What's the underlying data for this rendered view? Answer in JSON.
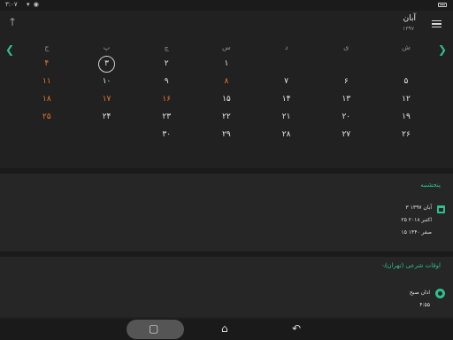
{
  "status": {
    "time": "۳:۰۷",
    "signal": "▾ ◉"
  },
  "header": {
    "up_arrow": "↑",
    "month": "آبان",
    "year": "۱۳۹۷",
    "menu_icon": "menu-icon"
  },
  "nav": {
    "prev": "❮",
    "next": "❯"
  },
  "weekdays": [
    "ج",
    "پ",
    "چ",
    "س",
    "د",
    "ی",
    "ش"
  ],
  "weeks": [
    [
      "۴",
      "۳",
      "۲",
      "۱",
      "",
      "",
      ""
    ],
    [
      "۱۱",
      "۱۰",
      "۹",
      "۸",
      "۷",
      "۶",
      "۵"
    ],
    [
      "۱۸",
      "۱۷",
      "۱۶",
      "۱۵",
      "۱۴",
      "۱۳",
      "۱۲"
    ],
    [
      "۲۵",
      "۲۴",
      "۲۳",
      "۲۲",
      "۲۱",
      "۲۰",
      "۱۹"
    ],
    [
      "",
      "",
      "۳۰",
      "۲۹",
      "۲۸",
      "۲۷",
      "۲۶"
    ]
  ],
  "day_card": {
    "day_name": "پنجشنبه",
    "shamsi": "۳ آبان ۱۳۹۷",
    "gregorian": "۲۵ اکتبر ۲۰۱۸",
    "hijri": "۱۵ صفر ۱۴۴۰"
  },
  "owqat": {
    "title": "اوقات شرعی (تهران)",
    "prayer_name": "اذان صبح",
    "prayer_time": "۴:۵۵"
  },
  "navbar": {
    "recents": "▢",
    "home": "⌂",
    "back": "↶"
  },
  "colors": {
    "accent": "#2fbf8f",
    "holiday": "#e57a2e",
    "background": "#212121"
  }
}
